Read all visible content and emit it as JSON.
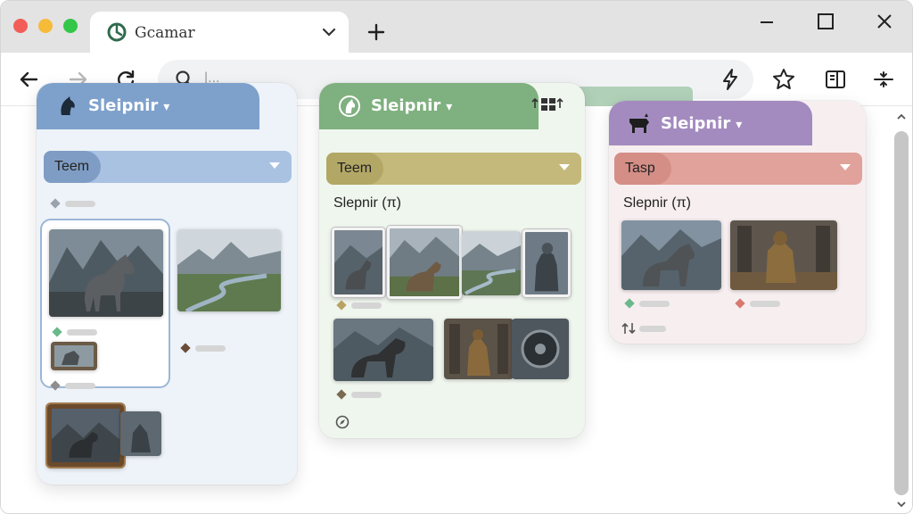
{
  "browser": {
    "tab_title": "Gcamar",
    "omnibox_text": "|...",
    "colors": {
      "chrome": "#e3e3e3",
      "red": "#f25e57",
      "yellow": "#f7bb3a",
      "green": "#33c648"
    }
  },
  "panels": [
    {
      "name": "Sleipnir",
      "team_label": "Teem",
      "colors": {
        "head": "#7ea1cc",
        "bar": "#a9c2e2",
        "pill": "#7f9dc4",
        "bg": "#eef3f9"
      }
    },
    {
      "name": "Sleipnir",
      "team_label": "Teem",
      "subtitle": "Slepnir (π)",
      "colors": {
        "head": "#7fb07f",
        "bar": "#c4b97a",
        "pill": "#b3a766",
        "bg": "#eff6ee"
      }
    },
    {
      "name": "Sleipnir",
      "team_label": "Tasp",
      "subtitle": "Slepnir (π)",
      "colors": {
        "head": "#a38bbf",
        "bar": "#e0a29a",
        "pill": "#d48e86",
        "bg": "#f7eef0"
      }
    }
  ],
  "icons": [
    "back-icon",
    "forward-icon",
    "reload-icon",
    "search-icon",
    "bolt-icon",
    "star-icon",
    "sidebar-icon",
    "menu-icon",
    "grid-icon",
    "plus-icon"
  ]
}
